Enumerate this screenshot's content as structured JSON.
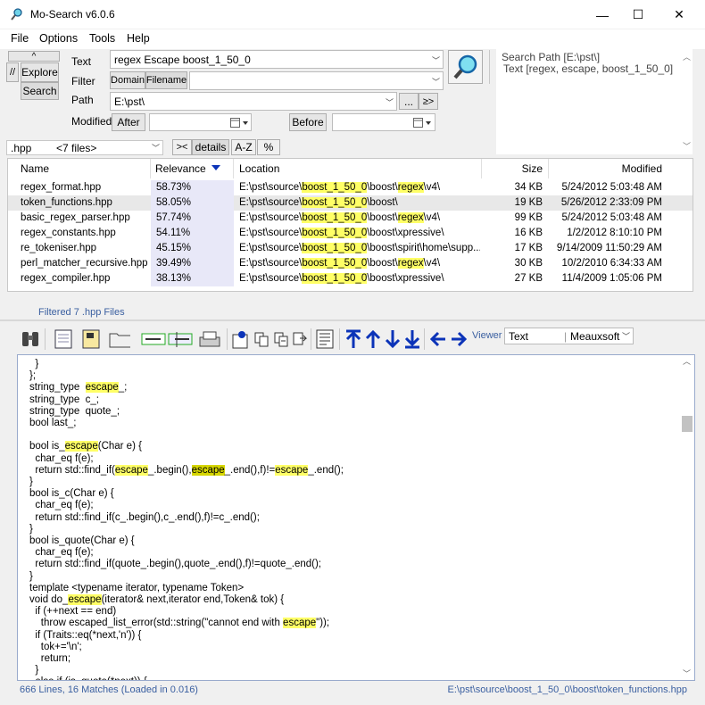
{
  "window": {
    "title": "Mo-Search v6.0.6",
    "minimize": "—",
    "maximize": "☐",
    "close": "✕"
  },
  "menu": [
    "File",
    "Options",
    "Tools",
    "Help"
  ],
  "side": {
    "up": "^",
    "explore": "Explore",
    "search": "Search",
    "slashes": "//"
  },
  "search": {
    "text_label": "Text",
    "text_value": "regex Escape boost_1_50_0",
    "filter_label": "Filter",
    "domain": "Domain",
    "filename": "Filename",
    "filter_value": "",
    "path_label": "Path",
    "path_value": "E:\\pst\\",
    "browse": "...",
    "go": "≥>",
    "modified_label": "Modified",
    "after": "After",
    "before": "Before",
    "summary_path": "Search Path [E:\\pst\\]",
    "summary_text": "Text [regex, escape, boost_1_50_0]"
  },
  "filebar": {
    "ext": ".hpp",
    "count": "<7 files>",
    "toggle": "><",
    "details": "details",
    "az": "A-Z",
    "pct": "%"
  },
  "columns": {
    "name": "Name",
    "relevance": "Relevance",
    "location": "Location",
    "size": "Size",
    "modified": "Modified"
  },
  "files": [
    {
      "name": "regex_format.hpp",
      "rel": "58.73%",
      "loc_pre": "E:\\pst\\source\\",
      "loc_hl": "boost_1_50_0",
      "loc_mid": "\\boost\\",
      "loc_hl2": "regex",
      "loc_post": "\\v4\\",
      "size": "34 KB",
      "modified": "5/24/2012 5:03:48 AM"
    },
    {
      "name": "token_functions.hpp",
      "rel": "58.05%",
      "loc_pre": "E:\\pst\\source\\",
      "loc_hl": "boost_1_50_0",
      "loc_mid": "\\boost\\",
      "loc_hl2": "",
      "loc_post": "",
      "size": "19 KB",
      "modified": "5/26/2012 2:33:09 PM"
    },
    {
      "name": "basic_regex_parser.hpp",
      "rel": "57.74%",
      "loc_pre": "E:\\pst\\source\\",
      "loc_hl": "boost_1_50_0",
      "loc_mid": "\\boost\\",
      "loc_hl2": "regex",
      "loc_post": "\\v4\\",
      "size": "99 KB",
      "modified": "5/24/2012 5:03:48 AM"
    },
    {
      "name": "regex_constants.hpp",
      "rel": "54.11%",
      "loc_pre": "E:\\pst\\source\\",
      "loc_hl": "boost_1_50_0",
      "loc_mid": "\\boost\\xpressive\\",
      "loc_hl2": "",
      "loc_post": "",
      "size": "16 KB",
      "modified": "1/2/2012 8:10:10 PM"
    },
    {
      "name": "re_tokeniser.hpp",
      "rel": "45.15%",
      "loc_pre": "E:\\pst\\source\\",
      "loc_hl": "boost_1_50_0",
      "loc_mid": "\\boost\\spirit\\home\\supp...",
      "loc_hl2": "",
      "loc_post": "",
      "size": "17 KB",
      "modified": "9/14/2009 11:50:29 AM"
    },
    {
      "name": "perl_matcher_recursive.hpp",
      "rel": "39.49%",
      "loc_pre": "E:\\pst\\source\\",
      "loc_hl": "boost_1_50_0",
      "loc_mid": "\\boost\\",
      "loc_hl2": "regex",
      "loc_post": "\\v4\\",
      "size": "30 KB",
      "modified": "10/2/2010 6:34:33 AM"
    },
    {
      "name": "regex_compiler.hpp",
      "rel": "38.13%",
      "loc_pre": "E:\\pst\\source\\",
      "loc_hl": "boost_1_50_0",
      "loc_mid": "\\boost\\xpressive\\",
      "loc_hl2": "",
      "loc_post": "",
      "size": "27 KB",
      "modified": "11/4/2009 1:05:06 PM"
    }
  ],
  "filtered": "Filtered 7 .hpp Files",
  "viewer": {
    "label": "Viewer",
    "mode": "Text",
    "font": "Meauxsoft"
  },
  "status": {
    "left": "666 Lines, 16 Matches (Loaded in 0.016)",
    "right": "E:\\pst\\source\\boost_1_50_0\\boost\\token_functions.hpp"
  },
  "colors": {
    "highlight": "#ffff66",
    "current_match": "#d6d600",
    "accent": "#0b33b8",
    "blue_text": "#3a5fa0"
  },
  "code_lines": [
    "  }",
    "};",
    "string_type  {escape}_;",
    "string_type  c_;",
    "string_type  quote_;",
    "bool last_;",
    "",
    "bool is_{escape}(Char e) {",
    "  char_eq f(e);",
    "  return std::find_if({escape}_.begin(),[escape]_.end(),f)!={escape}_.end();",
    "}",
    "bool is_c(Char e) {",
    "  char_eq f(e);",
    "  return std::find_if(c_.begin(),c_.end(),f)!=c_.end();",
    "}",
    "bool is_quote(Char e) {",
    "  char_eq f(e);",
    "  return std::find_if(quote_.begin(),quote_.end(),f)!=quote_.end();",
    "}",
    "template <typename iterator, typename Token>",
    "void do_{escape}(iterator& next,iterator end,Token& tok) {",
    "  if (++next == end)",
    "    throw escaped_list_error(std::string(\"cannot end with {escape}\"));",
    "  if (Traits::eq(*next,'n')) {",
    "    tok+='\\n';",
    "    return;",
    "  }",
    "  else if (is_quote(*next)) {"
  ]
}
